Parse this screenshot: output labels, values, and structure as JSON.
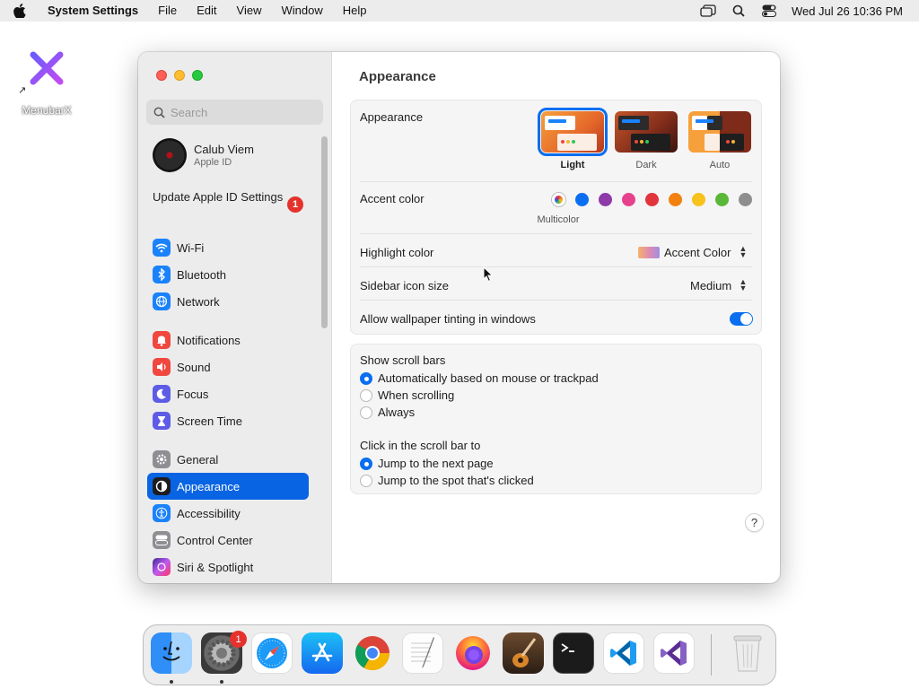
{
  "menubar": {
    "app_name": "System Settings",
    "items": [
      "File",
      "Edit",
      "View",
      "Window",
      "Help"
    ],
    "clock": "Wed Jul 26  10:36 PM"
  },
  "desktop": {
    "icon_label": "MenubarX"
  },
  "sidebar": {
    "search_placeholder": "Search",
    "profile": {
      "name": "Calub Viem",
      "subtitle": "Apple ID"
    },
    "update": {
      "label": "Update Apple ID Settings",
      "badge": "1"
    },
    "items": [
      {
        "label": "Wi-Fi",
        "icon": "wifi-icon",
        "color": "#1a82fb"
      },
      {
        "label": "Bluetooth",
        "icon": "bluetooth-icon",
        "color": "#1a82fb"
      },
      {
        "label": "Network",
        "icon": "globe-icon",
        "color": "#1a82fb"
      },
      {
        "label": "Notifications",
        "icon": "bell-icon",
        "color": "#f0473f"
      },
      {
        "label": "Sound",
        "icon": "speaker-icon",
        "color": "#f0473f"
      },
      {
        "label": "Focus",
        "icon": "moon-icon",
        "color": "#5e5ce6"
      },
      {
        "label": "Screen Time",
        "icon": "hourglass-icon",
        "color": "#5e5ce6"
      },
      {
        "label": "General",
        "icon": "gear-icon",
        "color": "#8e8e93"
      },
      {
        "label": "Appearance",
        "icon": "appearance-icon",
        "color": "#1d1d1f"
      },
      {
        "label": "Accessibility",
        "icon": "accessibility-icon",
        "color": "#1a82fb"
      },
      {
        "label": "Control Center",
        "icon": "control-center-icon",
        "color": "#8e8e93"
      },
      {
        "label": "Siri & Spotlight",
        "icon": "siri-icon",
        "color": "#bf5af2"
      }
    ],
    "selected": "Appearance"
  },
  "content": {
    "title": "Appearance",
    "appearance": {
      "label": "Appearance",
      "options": [
        {
          "label": "Light",
          "selected": true
        },
        {
          "label": "Dark",
          "selected": false
        },
        {
          "label": "Auto",
          "selected": false
        }
      ]
    },
    "accent": {
      "label": "Accent color",
      "colors": [
        "#0a6ef0",
        "#8e3aa8",
        "#e6418c",
        "#e2343c",
        "#f1800f",
        "#f7c21a",
        "#5ab738",
        "#8e8e8e"
      ],
      "selected_label": "Multicolor"
    },
    "highlight": {
      "label": "Highlight color",
      "value": "Accent Color"
    },
    "sidebar_icon_size": {
      "label": "Sidebar icon size",
      "value": "Medium"
    },
    "wallpaper_tinting": {
      "label": "Allow wallpaper tinting in windows",
      "enabled": true
    },
    "scroll_bars": {
      "label": "Show scroll bars",
      "options": [
        "Automatically based on mouse or trackpad",
        "When scrolling",
        "Always"
      ],
      "selected": 0
    },
    "click_scroll_bar": {
      "label": "Click in the scroll bar to",
      "options": [
        "Jump to the next page",
        "Jump to the spot that's clicked"
      ],
      "selected": 0
    },
    "help_label": "?"
  },
  "dock": {
    "apps": [
      "Finder",
      "System Settings",
      "Safari",
      "App Store",
      "Chrome",
      "TextEdit",
      "Firefox",
      "GarageBand",
      "Terminal",
      "VS Code",
      "Visual Studio",
      "Trash"
    ],
    "settings_badge": "1"
  }
}
